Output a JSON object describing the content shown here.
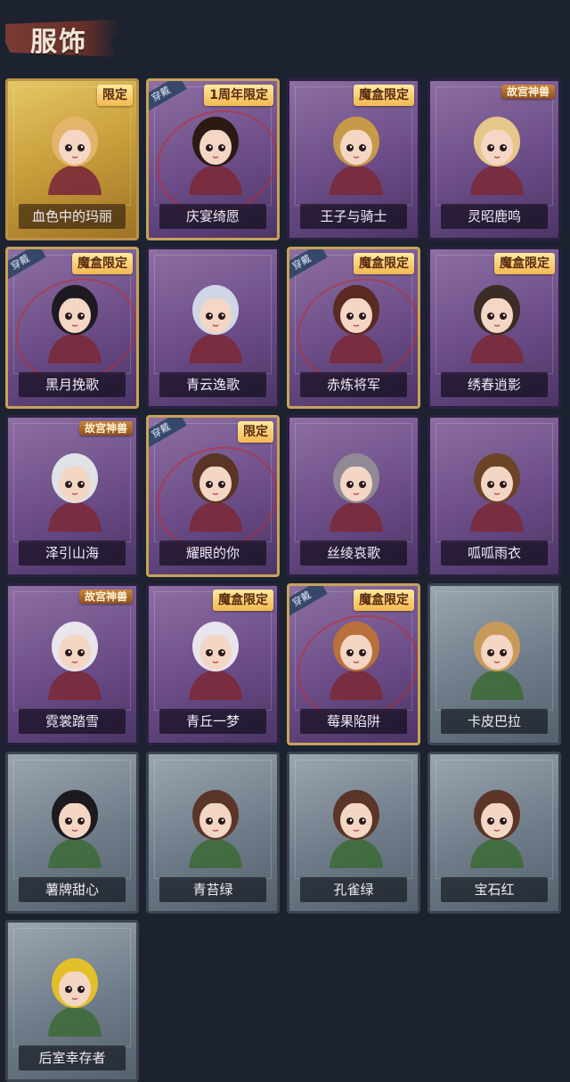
{
  "title": "服饰",
  "colors": {
    "background": "#1c2230",
    "title_brush": "#7a3b34",
    "purple_card": "#6b4c87",
    "gold_card": "#c79c3a",
    "grey_card": "#6e7b88",
    "tag": "#f2b950",
    "label_text": "#f2ecf6"
  },
  "wear_label": "穿戴",
  "cards": [
    {
      "name": "血色中的玛丽",
      "tag": "限定",
      "style": "gold",
      "wearing": false
    },
    {
      "name": "庆宴绮愿",
      "tag": "1周年限定",
      "style": "purple",
      "wearing": true
    },
    {
      "name": "王子与骑士",
      "tag": "魔盒限定",
      "style": "purple",
      "wearing": false
    },
    {
      "name": "灵昭鹿鸣",
      "tag": "故宫神兽",
      "style": "purple",
      "wearing": false
    },
    {
      "name": "黑月挽歌",
      "tag": "魔盒限定",
      "style": "purple",
      "wearing": true
    },
    {
      "name": "青云逸歌",
      "tag": "",
      "style": "purple",
      "wearing": false
    },
    {
      "name": "赤炼将军",
      "tag": "魔盒限定",
      "style": "purple",
      "wearing": true
    },
    {
      "name": "绣春逍影",
      "tag": "魔盒限定",
      "style": "purple",
      "wearing": false
    },
    {
      "name": "泽引山海",
      "tag": "故宫神兽",
      "style": "purple",
      "wearing": false
    },
    {
      "name": "耀眼的你",
      "tag": "限定",
      "style": "purple",
      "wearing": true
    },
    {
      "name": "丝绫哀歌",
      "tag": "",
      "style": "purple",
      "wearing": false
    },
    {
      "name": "呱呱雨衣",
      "tag": "",
      "style": "purple",
      "wearing": false
    },
    {
      "name": "霓裳踏雪",
      "tag": "故宫神兽",
      "style": "purple",
      "wearing": false
    },
    {
      "name": "青丘一梦",
      "tag": "魔盒限定",
      "style": "purple",
      "wearing": false
    },
    {
      "name": "莓果陷阱",
      "tag": "魔盒限定",
      "style": "purple",
      "wearing": true
    },
    {
      "name": "卡皮巴拉",
      "tag": "",
      "style": "grey",
      "wearing": false
    },
    {
      "name": "薯牌甜心",
      "tag": "",
      "style": "grey",
      "wearing": false
    },
    {
      "name": "青苔绿",
      "tag": "",
      "style": "grey",
      "wearing": false
    },
    {
      "name": "孔雀绿",
      "tag": "",
      "style": "grey",
      "wearing": false
    },
    {
      "name": "宝石红",
      "tag": "",
      "style": "grey",
      "wearing": false
    },
    {
      "name": "后室幸存者",
      "tag": "",
      "style": "grey",
      "wearing": false
    }
  ]
}
